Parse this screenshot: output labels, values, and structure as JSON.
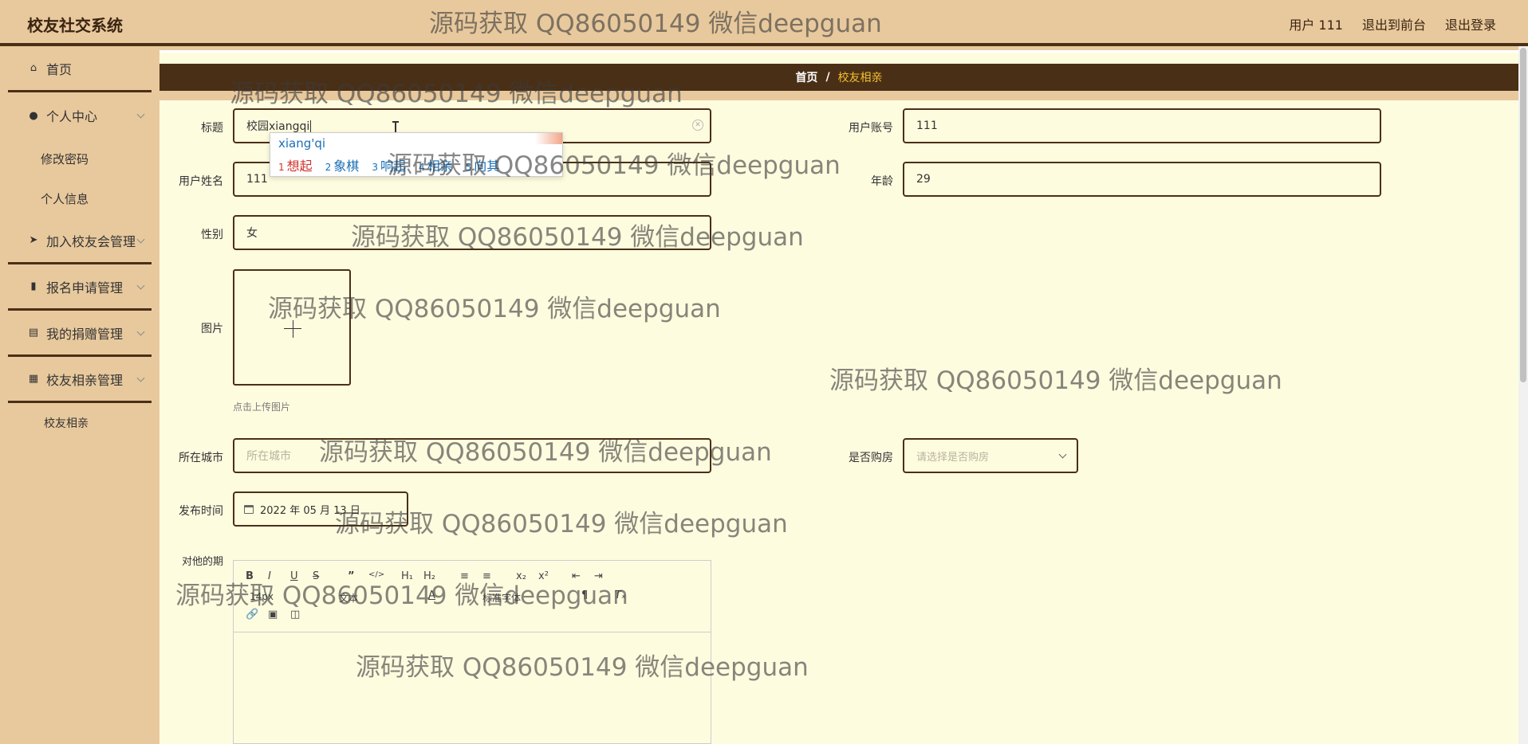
{
  "app": {
    "title": "校友社交系统"
  },
  "header": {
    "user_label": "用户 111",
    "front_label": "退出到前台",
    "logout_label": "退出登录"
  },
  "sidebar": {
    "items": [
      {
        "label": "首页",
        "icon": "home-icon"
      },
      {
        "label": "个人中心",
        "icon": "user-icon"
      },
      {
        "label": "修改密码"
      },
      {
        "label": "个人信息"
      },
      {
        "label": "加入校友会管理",
        "icon": "send-icon"
      },
      {
        "label": "报名申请管理",
        "icon": "briefcase-icon"
      },
      {
        "label": "我的捐赠管理",
        "icon": "clipboard-icon"
      },
      {
        "label": "校友相亲管理",
        "icon": "grid-icon"
      },
      {
        "label": "校友相亲"
      }
    ]
  },
  "breadcrumb": {
    "home": "首页",
    "separator": "/",
    "current": "校友相亲"
  },
  "form": {
    "title": {
      "label": "标题",
      "value": "校园xiangqi"
    },
    "account": {
      "label": "用户账号",
      "value": "111"
    },
    "name": {
      "label": "用户姓名",
      "value": "111"
    },
    "age": {
      "label": "年龄",
      "value": "29"
    },
    "gender": {
      "label": "性别",
      "value": "女"
    },
    "image": {
      "label": "图片",
      "hint": "点击上传图片"
    },
    "city": {
      "label": "所在城市",
      "placeholder": "所在城市"
    },
    "house": {
      "label": "是否购房",
      "placeholder": "请选择是否购房"
    },
    "publish_time": {
      "label": "发布时间",
      "value": "2022 年 05 月 13 日"
    },
    "expectation": {
      "label": "对他的期"
    }
  },
  "ime": {
    "pinyin": "xiang'qi",
    "candidates": [
      {
        "num": "1",
        "text": "想起"
      },
      {
        "num": "2",
        "text": "象棋"
      },
      {
        "num": "3",
        "text": "响起"
      },
      {
        "num": "4",
        "text": "相亲"
      },
      {
        "num": "5",
        "text": "向其"
      }
    ]
  },
  "editor": {
    "buttons": [
      "B",
      "I",
      "U",
      "S",
      "”",
      "</>",
      "H₁",
      "H₂",
      "≡",
      "≡",
      "x₂",
      "x²",
      "⇤",
      "⇥",
      "¶",
      "A",
      "Tₓ"
    ],
    "size_select": "14px",
    "text_select": "文本",
    "font_select": "标准字体"
  },
  "watermark": "源码获取 QQ86050149 微信deepguan"
}
